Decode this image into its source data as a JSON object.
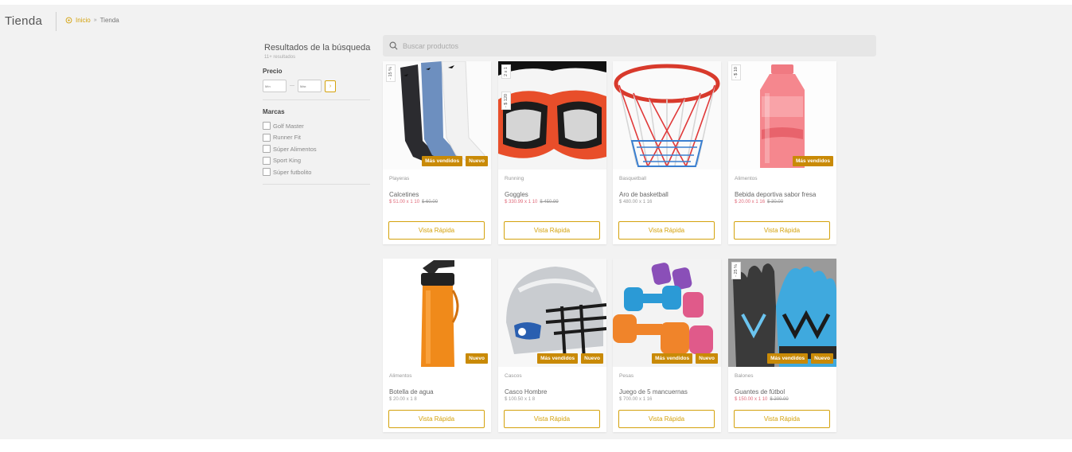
{
  "header": {
    "title": "Tienda",
    "breadcrumb": {
      "home": "Inicio",
      "separator": "»",
      "current": "Tienda"
    }
  },
  "sidebar": {
    "title": "Resultados de la búsqueda",
    "count": "11+ resultados",
    "price_title": "Precio",
    "price_min_placeholder": "Mín",
    "price_max_placeholder": "Máx",
    "price_go": "›",
    "brands_title": "Marcas",
    "brands": [
      "Golf Master",
      "Runner Fit",
      "Súper Alimentos",
      "Sport King",
      "Súper futbolito"
    ]
  },
  "search": {
    "placeholder": "Buscar productos"
  },
  "quick_view_label": "Vista Rápida",
  "colors": {
    "accent": "#d4a20c",
    "badge": "#c98a06",
    "sale_price": "#e06a7a"
  },
  "products": [
    {
      "category": "Playeras",
      "name": "Calcetines",
      "price": "$ 51.00 x 1 10",
      "old_price": "$ 60.00",
      "badges": [
        "Más vendidos",
        "Nuevo"
      ],
      "promo": [
        "- 15 %"
      ]
    },
    {
      "category": "Running",
      "name": "Goggles",
      "price": "$ 330.99 x 1 10",
      "old_price": "$ 450.99",
      "badges": [],
      "promo": [
        "2 x 1",
        "- $ 120"
      ]
    },
    {
      "category": "Basquetball",
      "name": "Aro de basketball",
      "price": "$ 480.00 x 1 16",
      "old_price": "",
      "badges": [],
      "promo": []
    },
    {
      "category": "Alimentos",
      "name": "Bebida deportiva sabor fresa",
      "price": "$ 20.00 x 1 16",
      "old_price": "$ 30.00",
      "badges": [
        "Más vendidos"
      ],
      "promo": [
        "- $ 10"
      ]
    },
    {
      "category": "Alimentos",
      "name": "Botella de agua",
      "price": "$ 20.00 x 1 8",
      "old_price": "",
      "badges": [
        "Nuevo"
      ],
      "promo": []
    },
    {
      "category": "Cascos",
      "name": "Casco Hombre",
      "price": "$ 100.50 x 1 8",
      "old_price": "",
      "badges": [
        "Más vendidos",
        "Nuevo"
      ],
      "promo": []
    },
    {
      "category": "Pesas",
      "name": "Juego de 5 mancuernas",
      "price": "$ 700.00 x 1 16",
      "old_price": "",
      "badges": [
        "Más vendidos",
        "Nuevo"
      ],
      "promo": []
    },
    {
      "category": "Balones",
      "name": "Guantes de fútbol",
      "price": "$ 150.00 x 1 10",
      "old_price": "$ 200.00",
      "badges": [
        "Más vendidos",
        "Nuevo"
      ],
      "promo": [
        "- 25 %"
      ]
    }
  ]
}
